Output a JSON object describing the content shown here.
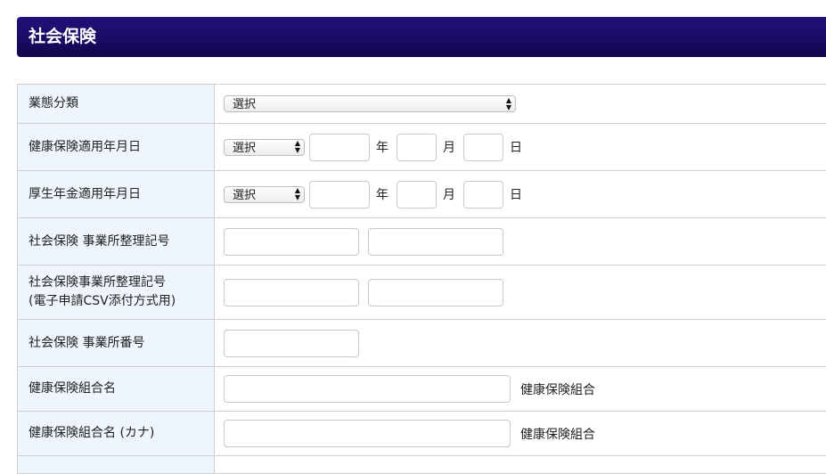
{
  "header": {
    "title": "社会保険"
  },
  "rows": [
    {
      "label": "業態分類",
      "select_value": "選択"
    },
    {
      "label": "健康保険適用年月日",
      "select_value": "選択",
      "year_unit": "年",
      "month_unit": "月",
      "day_unit": "日"
    },
    {
      "label": "厚生年金適用年月日",
      "select_value": "選択",
      "year_unit": "年",
      "month_unit": "月",
      "day_unit": "日"
    },
    {
      "label": "社会保険 事業所整理記号"
    },
    {
      "label_line1": "社会保険事業所整理記号",
      "label_line2": "(電子申請CSV添付方式用)"
    },
    {
      "label": "社会保険 事業所番号"
    },
    {
      "label": "健康保険組合名",
      "suffix": "健康保険組合"
    },
    {
      "label": "健康保険組合名 (カナ)",
      "suffix": "健康保険組合"
    }
  ]
}
